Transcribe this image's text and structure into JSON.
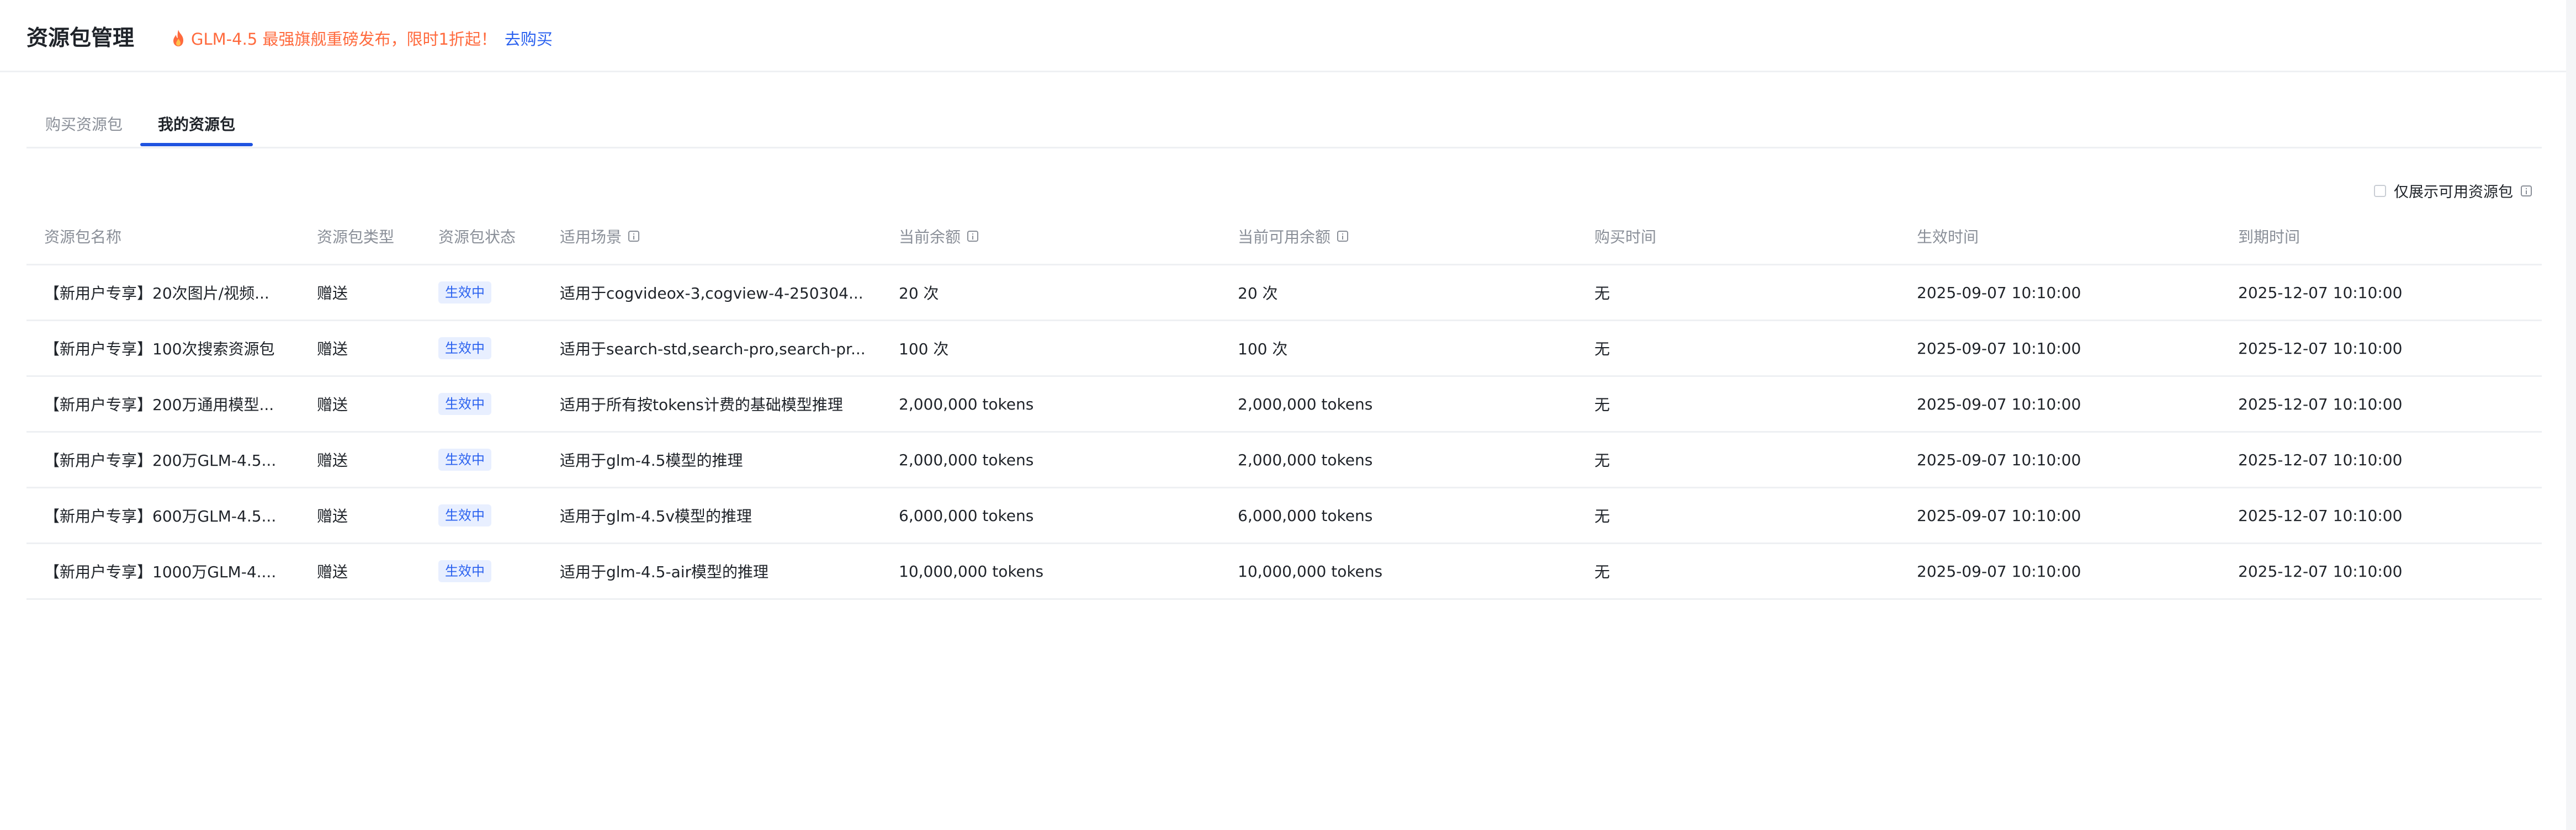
{
  "header": {
    "title": "资源包管理",
    "promo_icon": "fire-icon",
    "promo_text": "GLM-4.5 最强旗舰重磅发布，限时1折起！",
    "promo_link": "去购买",
    "promo_color": "#ff6a3d",
    "link_color": "#2a61ef"
  },
  "tabs": [
    {
      "label": "购买资源包",
      "active": false
    },
    {
      "label": "我的资源包",
      "active": true
    }
  ],
  "filter": {
    "label": "仅展示可用资源包",
    "checked": false
  },
  "table": {
    "columns": [
      "资源包名称",
      "资源包类型",
      "资源包状态",
      "适用场景",
      "当前余额",
      "当前可用余额",
      "购买时间",
      "生效时间",
      "到期时间"
    ],
    "rows": [
      {
        "name": "【新用户专享】20次图片/视频...",
        "type": "赠送",
        "status": "生效中",
        "scene": "适用于cogvideox-3,cogview-4-250304...",
        "balance": "20 次",
        "available": "20 次",
        "purchase": "无",
        "effective": "2025-09-07 10:10:00",
        "expire": "2025-12-07 10:10:00"
      },
      {
        "name": "【新用户专享】100次搜索资源包",
        "type": "赠送",
        "status": "生效中",
        "scene": "适用于search-std,search-pro,search-pr...",
        "balance": "100 次",
        "available": "100 次",
        "purchase": "无",
        "effective": "2025-09-07 10:10:00",
        "expire": "2025-12-07 10:10:00"
      },
      {
        "name": "【新用户专享】200万通用模型...",
        "type": "赠送",
        "status": "生效中",
        "scene": "适用于所有按tokens计费的基础模型推理",
        "balance": "2,000,000 tokens",
        "available": "2,000,000 tokens",
        "purchase": "无",
        "effective": "2025-09-07 10:10:00",
        "expire": "2025-12-07 10:10:00"
      },
      {
        "name": "【新用户专享】200万GLM-4.5...",
        "type": "赠送",
        "status": "生效中",
        "scene": "适用于glm-4.5模型的推理",
        "balance": "2,000,000 tokens",
        "available": "2,000,000 tokens",
        "purchase": "无",
        "effective": "2025-09-07 10:10:00",
        "expire": "2025-12-07 10:10:00"
      },
      {
        "name": "【新用户专享】600万GLM-4.5...",
        "type": "赠送",
        "status": "生效中",
        "scene": "适用于glm-4.5v模型的推理",
        "balance": "6,000,000 tokens",
        "available": "6,000,000 tokens",
        "purchase": "无",
        "effective": "2025-09-07 10:10:00",
        "expire": "2025-12-07 10:10:00"
      },
      {
        "name": "【新用户专享】1000万GLM-4....",
        "type": "赠送",
        "status": "生效中",
        "scene": "适用于glm-4.5-air模型的推理",
        "balance": "10,000,000 tokens",
        "available": "10,000,000 tokens",
        "purchase": "无",
        "effective": "2025-09-07 10:10:00",
        "expire": "2025-12-07 10:10:00"
      }
    ]
  },
  "colors": {
    "accent": "#1f53e0",
    "badge_bg": "#e8efff",
    "badge_text": "#2a61ef",
    "muted_text": "#8a8f98"
  }
}
